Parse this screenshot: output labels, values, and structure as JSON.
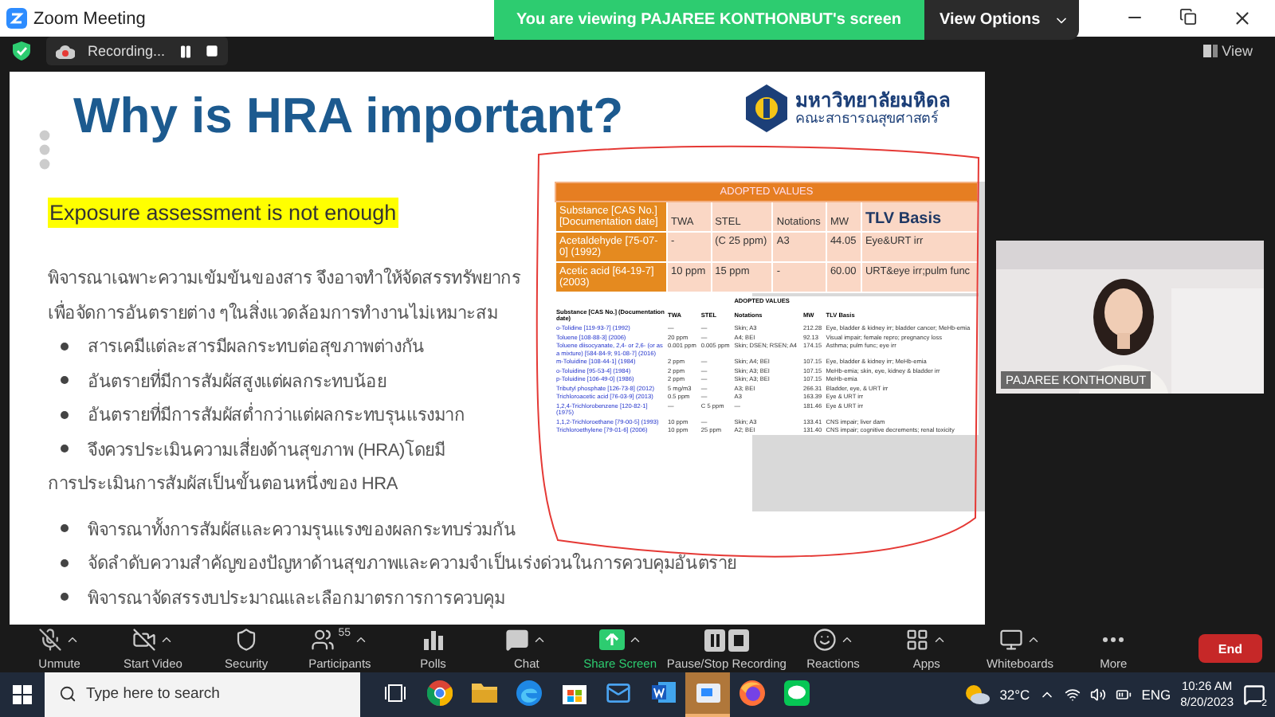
{
  "window": {
    "title": "Zoom Meeting",
    "banner": "You are viewing PAJAREE KONTHONBUT's screen",
    "view_options": "View Options"
  },
  "meeting_bar": {
    "recording": "Recording...",
    "view": "View"
  },
  "slide": {
    "title": "Why is HRA important?",
    "highlight": "Exposure assessment is not enough",
    "logo": {
      "university": "มหาวิทยาลัยมหิดล",
      "faculty": "คณะสาธารณสุขศาสตร์"
    },
    "upper_lines": [
      {
        "kind": "text",
        "text": "พิจารณาเฉพาะความเข้มข้นของสาร จึงอาจทำให้จัดสรรทรัพยากร"
      },
      {
        "kind": "text",
        "text": "เพื่อจัดการอันตรายต่าง ๆในสิ่งแวดล้อมการทำงานไม่เหมาะสม"
      },
      {
        "kind": "bullet",
        "text": "สารเคมีแต่ละสารมีผลกระทบต่อสุขภาพต่างกัน"
      },
      {
        "kind": "bullet",
        "text": "อันตรายที่มีการสัมผัสสูงแต่ผลกระทบน้อย"
      },
      {
        "kind": "bullet",
        "text": "อันตรายที่มีการสัมผัสต่ำกว่าแต่ผลกระทบรุนแรงมาก"
      },
      {
        "kind": "bullet",
        "text": "จึงควรประเมินความเสี่ยงด้านสุขภาพ (HRA)โดยมี"
      },
      {
        "kind": "text",
        "text": "การประเมินการสัมผัสเป็นขั้นตอนหนึ่งของ HRA"
      }
    ],
    "lower_lines": [
      {
        "kind": "bullet",
        "text": "พิจารณาทั้งการสัมผัสและความรุนแรงของผลกระทบร่วมกัน"
      },
      {
        "kind": "bullet",
        "text": "จัดลำดับความสำคัญของปัญหาด้านสุขภาพและความจำเป็นเร่งด่วนในการควบคุมอันตราย"
      },
      {
        "kind": "bullet",
        "text": "พิจารณาจัดสรรงบประมาณและเลือกมาตรการการควบคุม"
      }
    ],
    "adopted_table": {
      "caption": "ADOPTED VALUES",
      "columns": [
        "Substance [CAS No.][Documentation date]",
        "TWA",
        "STEL",
        "Notations",
        "MW",
        "TLV Basis"
      ],
      "rows": [
        [
          "Acetaldehyde [75-07-0] (1992)",
          "-",
          "(C 25 ppm)",
          "A3",
          "44.05",
          "Eye&URT irr"
        ],
        [
          "Acetic acid [64-19-7] (2003)",
          "10 ppm",
          "15 ppm",
          "-",
          "60.00",
          "URT&eye irr;pulm func"
        ]
      ]
    },
    "reference_table": {
      "caption": "ADOPTED VALUES",
      "columns": [
        "Substance [CAS No.] (Documentation date)",
        "TWA",
        "STEL",
        "Notations",
        "MW",
        "TLV Basis"
      ],
      "rows": [
        [
          "o-Tolidine [119-93-7] (1992)",
          "—",
          "—",
          "Skin; A3",
          "212.28",
          "Eye, bladder & kidney irr; bladder cancer; MeHb-emia"
        ],
        [
          "Toluene [108-88-3] (2006)",
          "20 ppm",
          "—",
          "A4; BEI",
          "92.13",
          "Visual impair; female repro; pregnancy loss"
        ],
        [
          "Toluene diisocyanate, 2,4- or 2,6- (or as a mixture) [584-84-9; 91-08-7] (2016)",
          "0.001 ppm",
          "0.005 ppm",
          "Skin; DSEN; RSEN; A4",
          "174.15",
          "Asthma; pulm func; eye irr"
        ],
        [
          "m-Toluidine [108-44-1] (1984)",
          "2 ppm",
          "—",
          "Skin; A4; BEI",
          "107.15",
          "Eye, bladder & kidney irr; MeHb-emia"
        ],
        [
          "o-Toluidine [95-53-4] (1984)",
          "2 ppm",
          "—",
          "Skin; A3; BEI",
          "107.15",
          "MeHb-emia; skin, eye, kidney & bladder irr"
        ],
        [
          "p-Toluidine [106-49-0] (1986)",
          "2 ppm",
          "—",
          "Skin; A3; BEI",
          "107.15",
          "MeHb-emia"
        ],
        [
          "Tributyl phosphate [126-73-8] (2012)",
          "5 mg/m3",
          "—",
          "A3; BEI",
          "266.31",
          "Bladder, eye, & URT irr"
        ],
        [
          "Trichloroacetic acid [76-03-9] (2013)",
          "0.5 ppm",
          "—",
          "A3",
          "163.39",
          "Eye & URT irr"
        ],
        [
          "1,2,4-Trichlorobenzene [120-82-1] (1975)",
          "—",
          "C 5 ppm",
          "—",
          "181.46",
          "Eye & URT irr"
        ],
        [
          "1,1,2-Trichloroethane [79-00-5] (1993)",
          "10 ppm",
          "—",
          "Skin; A3",
          "133.41",
          "CNS impair; liver dam"
        ],
        [
          "Trichloroethylene [79-01-6] (2006)",
          "10 ppm",
          "25 ppm",
          "A2; BEI",
          "131.40",
          "CNS impair; cognitive decrements; renal toxicity"
        ]
      ]
    }
  },
  "video_tile": {
    "name": "PAJAREE KONTHONBUT"
  },
  "toolbar": {
    "items": [
      {
        "label": "Unmute",
        "caret": true
      },
      {
        "label": "Start Video",
        "caret": true
      },
      {
        "label": "Security",
        "caret": false
      },
      {
        "label": "Participants",
        "count": "55",
        "caret": true
      },
      {
        "label": "Polls",
        "caret": false
      },
      {
        "label": "Chat",
        "caret": true
      },
      {
        "label": "Share Screen",
        "caret": true
      },
      {
        "label": "Pause/Stop Recording",
        "caret": false
      },
      {
        "label": "Reactions",
        "caret": true
      },
      {
        "label": "Apps",
        "caret": true
      },
      {
        "label": "Whiteboards",
        "caret": true
      },
      {
        "label": "More",
        "caret": false
      }
    ],
    "end": "End"
  },
  "taskbar": {
    "search_placeholder": "Type here to search",
    "apps": [
      {
        "selected": false
      },
      {
        "selected": false
      },
      {
        "selected": false
      },
      {
        "selected": false
      },
      {
        "selected": false
      },
      {
        "selected": false
      },
      {
        "selected": false
      },
      {
        "selected": true
      },
      {
        "selected": false
      },
      {
        "selected": false
      }
    ],
    "weather": "32°C",
    "language": "ENG",
    "time": "10:26 AM",
    "date": "8/20/2023",
    "notifications": "2"
  }
}
